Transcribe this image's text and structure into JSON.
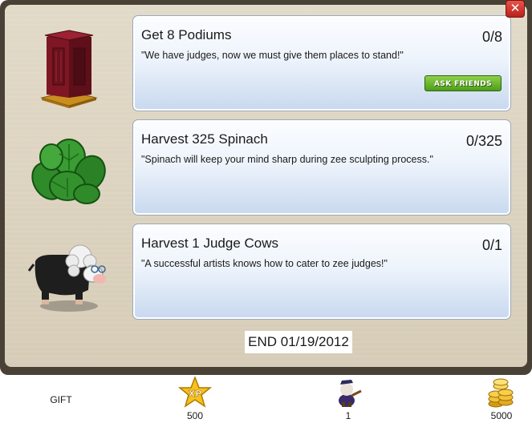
{
  "dialog": {
    "close_label": "✕",
    "end_date": "END 01/19/2012"
  },
  "tasks": [
    {
      "title": "Get 8 Podiums",
      "quote": "\"We have judges, now we must give them places to stand!\"",
      "progress": "0/8",
      "action_label": "ASK FRIENDS",
      "icon": "podium-icon"
    },
    {
      "title": "Harvest 325 Spinach",
      "quote": "\"Spinach will keep your mind sharp during zee sculpting process.\"",
      "progress": "0/325",
      "icon": "spinach-icon"
    },
    {
      "title": "Harvest 1 Judge Cows",
      "quote": "\"A successful artists knows how to cater to zee judges!\"",
      "progress": "0/1",
      "icon": "judge-cow-icon"
    }
  ],
  "rewards": {
    "gift_label": "GIFT",
    "xp_badge": "XP",
    "xp_value": "500",
    "item_value": "1",
    "coins_value": "5000"
  },
  "colors": {
    "frame": "#4a4136",
    "panel": "#dcd3c0",
    "task_border": "#9aa9bd",
    "ask_button": "#5aa824",
    "close_button": "#d23a31"
  }
}
